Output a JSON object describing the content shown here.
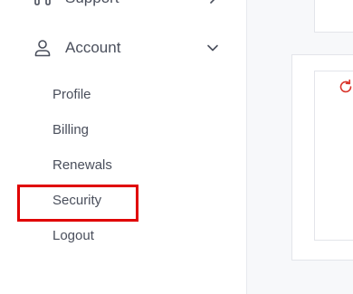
{
  "sidebar": {
    "support": {
      "label": "Support",
      "icon": "support-icon"
    },
    "account": {
      "label": "Account",
      "icon": "user-icon",
      "expanded": true,
      "items": [
        {
          "label": "Profile"
        },
        {
          "label": "Billing"
        },
        {
          "label": "Renewals"
        },
        {
          "label": "Security",
          "highlighted": true
        },
        {
          "label": "Logout"
        }
      ]
    }
  },
  "colors": {
    "highlight": "#e00000",
    "text": "#4a4f5c",
    "refresh_icon": "#d9342b"
  },
  "main": {
    "icon": "refresh-icon"
  }
}
